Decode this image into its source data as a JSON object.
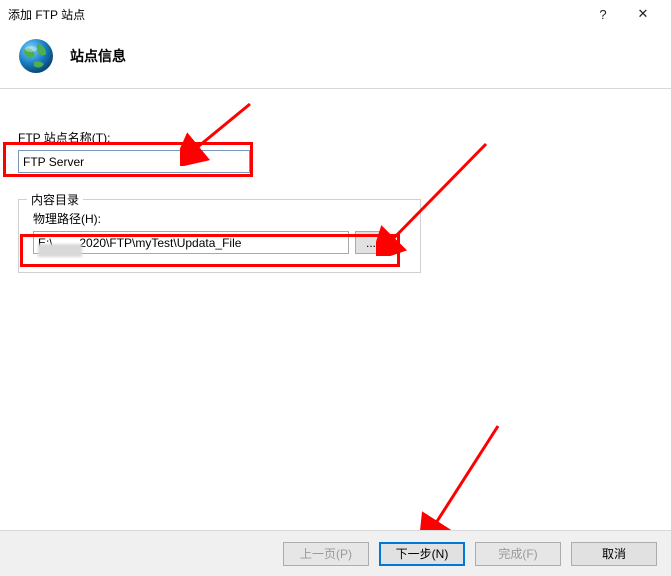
{
  "titlebar": {
    "title": "添加 FTP 站点",
    "help": "?",
    "close": "✕"
  },
  "header": {
    "title": "站点信息"
  },
  "fields": {
    "site_name_label": "FTP 站点名称(T):",
    "site_name_value": "FTP Server",
    "content_dir_legend": "内容目录",
    "physical_path_label": "物理路径(H):",
    "physical_path_value": "E:\\        2020\\FTP\\myTest\\Updata_File",
    "browse_label": "..."
  },
  "footer": {
    "prev": "上一页(P)",
    "next": "下一步(N)",
    "finish": "完成(F)",
    "cancel": "取消"
  }
}
